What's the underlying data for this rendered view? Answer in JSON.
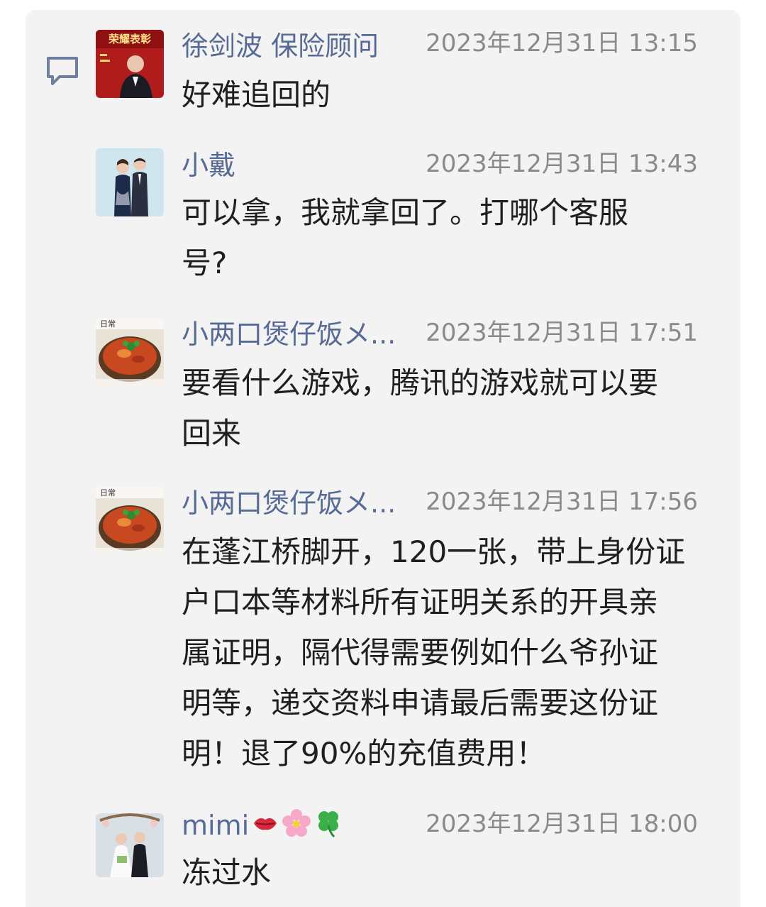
{
  "comments": [
    {
      "name": "徐剑波 保险顾问",
      "time": "2023年12月31日 13:15",
      "text": "好难追回的",
      "avatar_icon": "avatar-honor-poster",
      "avatar_text": "荣耀表彰"
    },
    {
      "name": "小戴",
      "time": "2023年12月31日 13:43",
      "text": "可以拿，我就拿回了。打哪个客服\n号?",
      "avatar_icon": "avatar-couple-photo"
    },
    {
      "name": "小两口煲仔饭メ...",
      "time": "2023年12月31日 17:51",
      "text": "要看什么游戏，腾讯的游戏就可以要\n回来",
      "avatar_icon": "avatar-claypot-rice",
      "avatar_text": "日常 "
    },
    {
      "name": "小两口煲仔饭メ...",
      "time": "2023年12月31日 17:56",
      "text": "在蓬江桥脚开，120一张，带上身份证\n户口本等材料所有证明关系的开具亲\n属证明，隔代得需要例如什么爷孙证\n明等，递交资料申请最后需要这份证\n明！退了90%的充值费用！",
      "avatar_icon": "avatar-claypot-rice",
      "avatar_text": "日常 "
    },
    {
      "name": "mimi",
      "name_emojis": [
        "lips-emoji",
        "cherry-blossom-emoji",
        "four-leaf-clover-emoji"
      ],
      "time": "2023年12月31日 18:00",
      "text": "冻过水",
      "avatar_icon": "avatar-wedding-photo"
    }
  ],
  "colors": {
    "panel_bg": "#f3f3f4",
    "name": "#576b95",
    "time": "#8a8a8a",
    "text": "#1f1f1f"
  },
  "comment_icon": "comment-bubble-icon"
}
